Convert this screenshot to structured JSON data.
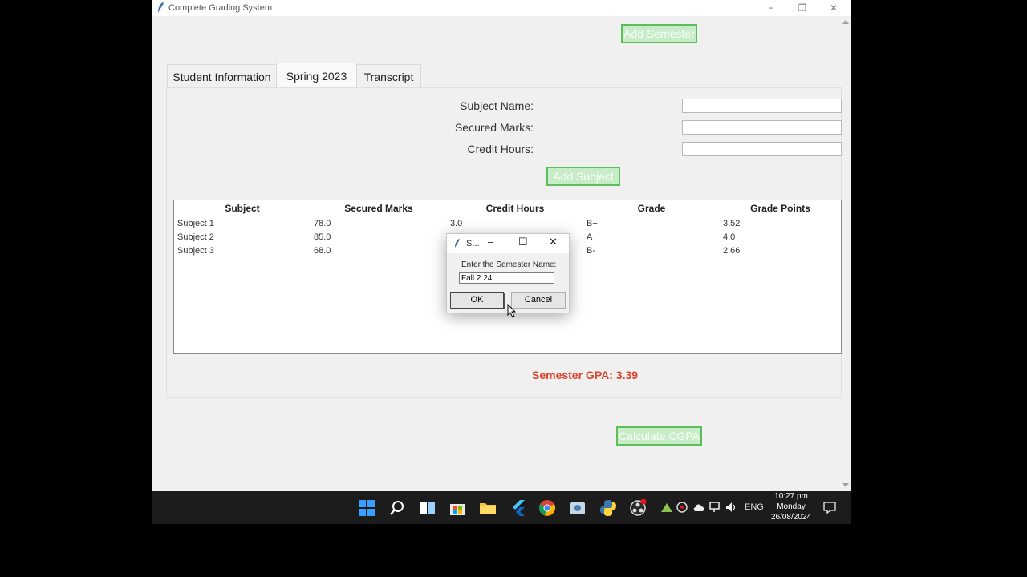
{
  "window": {
    "title": "Complete Grading System",
    "controls": {
      "minimize": "−",
      "maximize": "❐",
      "close": "✕"
    }
  },
  "buttons": {
    "add_semester": "Add Semester",
    "add_subject": "Add Subject",
    "calculate_cgpa": "Calculate CGPA"
  },
  "tabs": [
    {
      "label": "Student Information",
      "selected": false
    },
    {
      "label": "Spring 2023",
      "selected": true
    },
    {
      "label": "Transcript",
      "selected": false
    }
  ],
  "form": {
    "subject_name_label": "Subject Name:",
    "secured_marks_label": "Secured Marks:",
    "credit_hours_label": "Credit Hours:",
    "subject_name_value": "",
    "secured_marks_value": "",
    "credit_hours_value": ""
  },
  "table": {
    "columns": [
      "Subject",
      "Secured Marks",
      "Credit Hours",
      "Grade",
      "Grade Points"
    ],
    "rows": [
      [
        "Subject 1",
        "78.0",
        "3.0",
        "B+",
        "3.52"
      ],
      [
        "Subject 2",
        "85.0",
        "",
        "A",
        "4.0"
      ],
      [
        "Subject 3",
        "68.0",
        "",
        "B-",
        "2.66"
      ]
    ]
  },
  "semester_gpa": "Semester GPA: 3.39",
  "dialog": {
    "title": "S...",
    "prompt": "Enter the Semester Name:",
    "input_value": "Fall 2.24",
    "ok_label": "OK",
    "cancel_label": "Cancel",
    "controls": {
      "minimize": "–",
      "maximize": "☐",
      "close": "✕"
    }
  },
  "taskbar": {
    "language": "ENG",
    "time": "10:27 pm",
    "day": "Monday",
    "date": "26/08/2024",
    "icons": [
      "windows-start-icon",
      "search-icon",
      "task-view-icon",
      "store-icon",
      "file-explorer-icon",
      "flutter-icon",
      "chrome-icon",
      "app-icon",
      "python-icon",
      "obs-icon"
    ]
  },
  "colors": {
    "accent_green": "#5cbf5c",
    "gpa_red": "#d9442d",
    "taskbar": "#1c1c1c"
  }
}
